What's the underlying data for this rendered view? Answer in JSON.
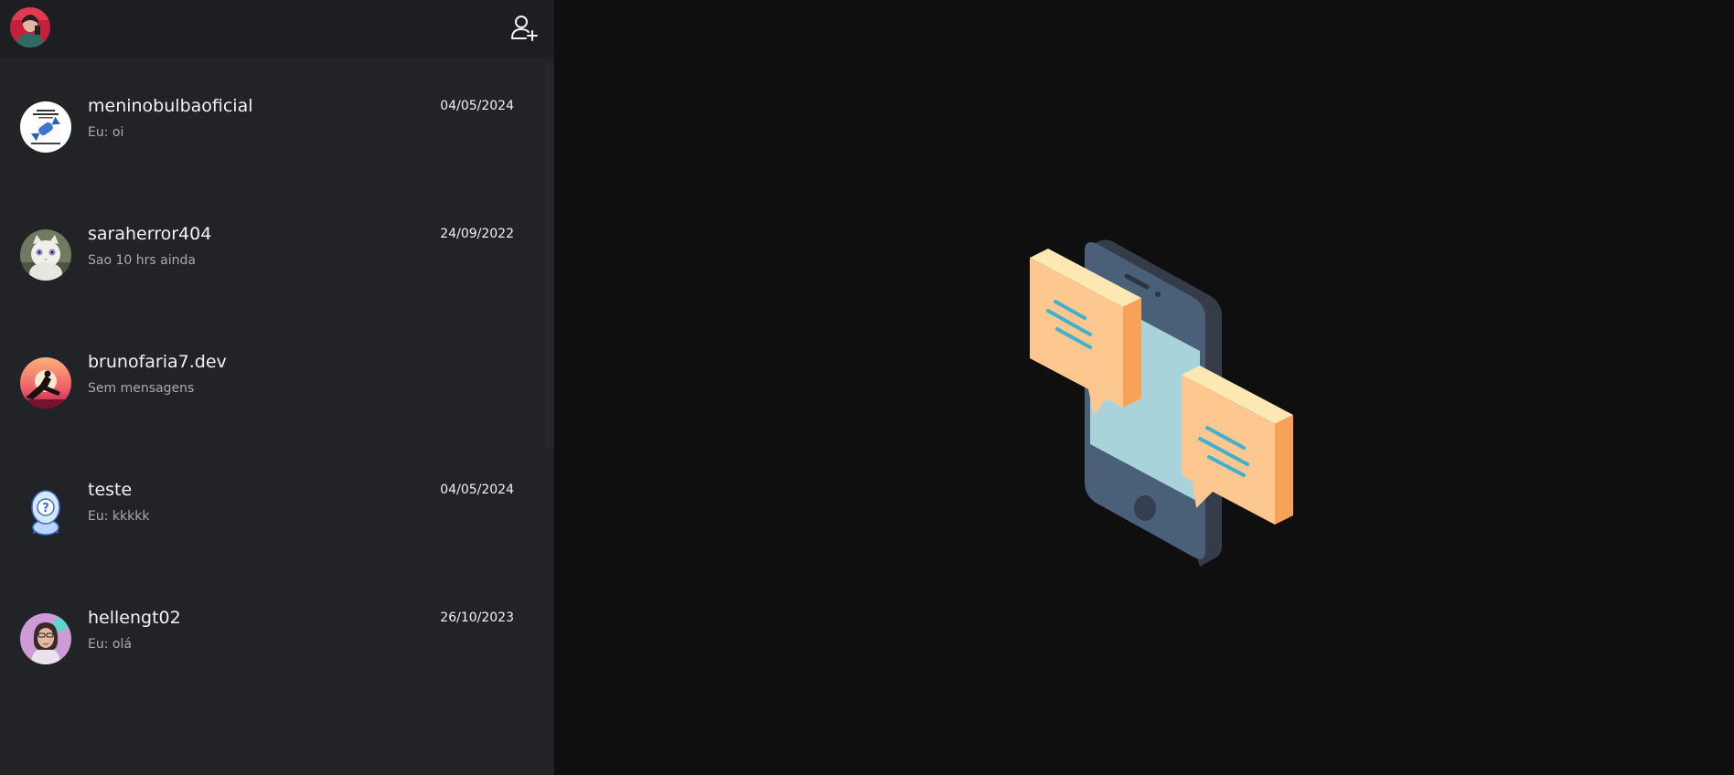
{
  "header": {
    "my_avatar_icon": "user-avatar",
    "add_contact_icon": "user-plus-icon"
  },
  "chats": [
    {
      "name": "meninobulbaoficial",
      "preview": "Eu: oi",
      "date": "04/05/2024",
      "avatar_icon": "candy-logo-avatar"
    },
    {
      "name": "saraherror404",
      "preview": "Sao 10 hrs ainda",
      "date": "24/09/2022",
      "avatar_icon": "white-cat-avatar"
    },
    {
      "name": "brunofaria7.dev",
      "preview": "Sem mensagens",
      "date": "",
      "avatar_icon": "sunset-runner-avatar"
    },
    {
      "name": "teste",
      "preview": "Eu: kkkkk",
      "date": "04/05/2024",
      "avatar_icon": "question-person-avatar"
    },
    {
      "name": "hellengt02",
      "preview": "Eu: olá",
      "date": "26/10/2023",
      "avatar_icon": "woman-portrait-avatar"
    }
  ],
  "main": {
    "illustration_icon": "phone-chat-bubbles-illustration"
  },
  "colors": {
    "sidebar_bg": "#222327",
    "header_bg": "#1d1e21",
    "main_bg": "#0f0f10",
    "text_primary": "#f2f2f2",
    "text_secondary": "#a9abb2"
  }
}
